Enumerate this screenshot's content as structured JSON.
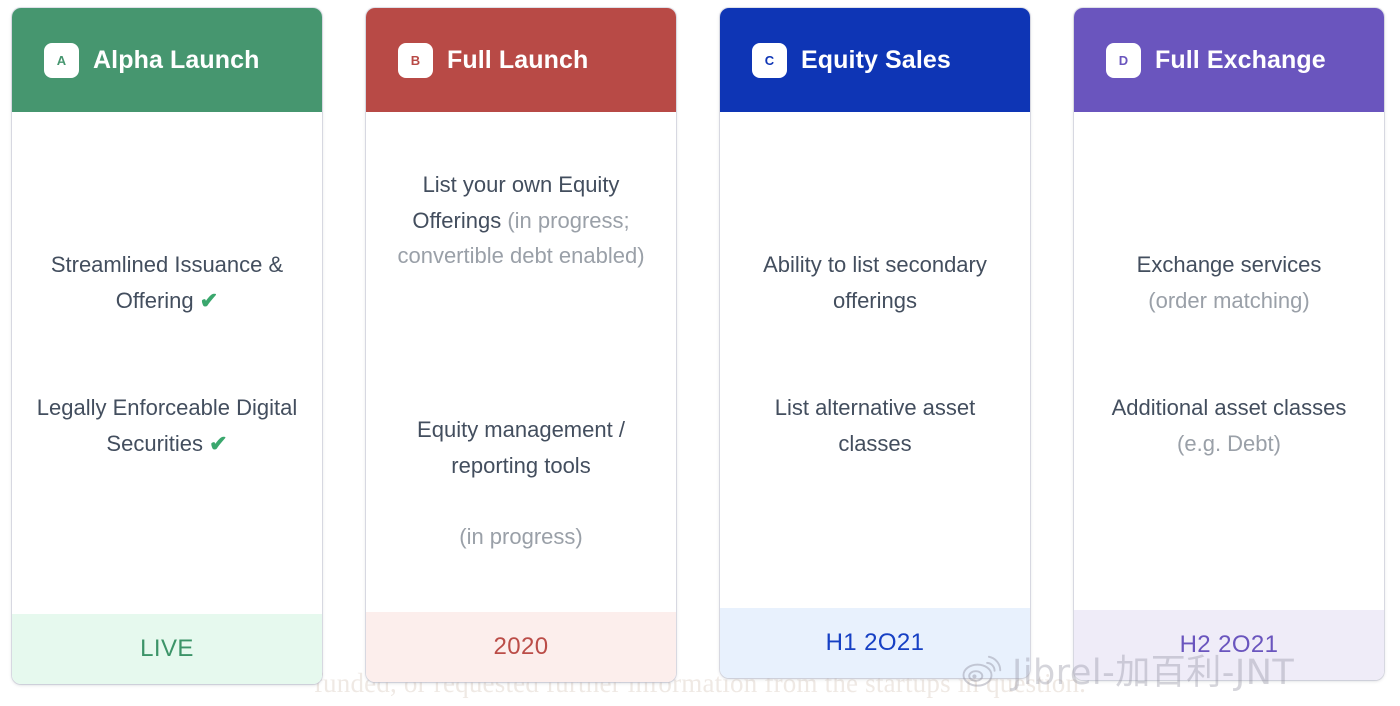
{
  "background_text": "funded, or requested further information from the startups in question.",
  "watermark": {
    "icon": "weibo-logo-icon",
    "text": "Jibrel-加百利-JNT"
  },
  "roadmap": {
    "cards": [
      {
        "id": "alpha-launch",
        "badge_letter": "A",
        "title": "Alpha Launch",
        "header_color": "#46966F",
        "footer_bg": "#E6F9EE",
        "footer_color": "#3C9468",
        "footer_label": "LIVE",
        "features": [
          {
            "main": "Streamlined Issuance & Offering",
            "check": "✔",
            "note": ""
          },
          {
            "main": "Legally Enforceable Digital Securities",
            "check": "✔",
            "note": ""
          }
        ]
      },
      {
        "id": "full-launch",
        "badge_letter": "B",
        "title": "Full Launch",
        "header_color": "#B84A46",
        "footer_bg": "#FCEEEC",
        "footer_color": "#BB4D48",
        "footer_label": "2020",
        "features": [
          {
            "main": "List your own Equity Offerings",
            "check": "",
            "note": "(in progress; convertible debt enabled)"
          },
          {
            "main": "Equity management / reporting tools",
            "check": "",
            "note": "(in progress)"
          }
        ]
      },
      {
        "id": "equity-sales",
        "badge_letter": "C",
        "title": "Equity Sales",
        "header_color": "#0E35B5",
        "footer_bg": "#E8F1FD",
        "footer_color": "#1640C4",
        "footer_label": "H1 2O21",
        "features": [
          {
            "main": "Ability to list secondary offerings",
            "check": "",
            "note": ""
          },
          {
            "main": "List alternative asset classes",
            "check": "",
            "note": ""
          }
        ]
      },
      {
        "id": "full-exchange",
        "badge_letter": "D",
        "title": "Full Exchange",
        "header_color": "#6A55BE",
        "footer_bg": "#EFECF8",
        "footer_color": "#6A55BE",
        "footer_label": "H2 2O21",
        "features": [
          {
            "main": "Exchange services",
            "check": "",
            "note": "(order matching)"
          },
          {
            "main": "Additional asset classes",
            "check": "",
            "note": "(e.g. Debt)"
          }
        ]
      }
    ]
  }
}
